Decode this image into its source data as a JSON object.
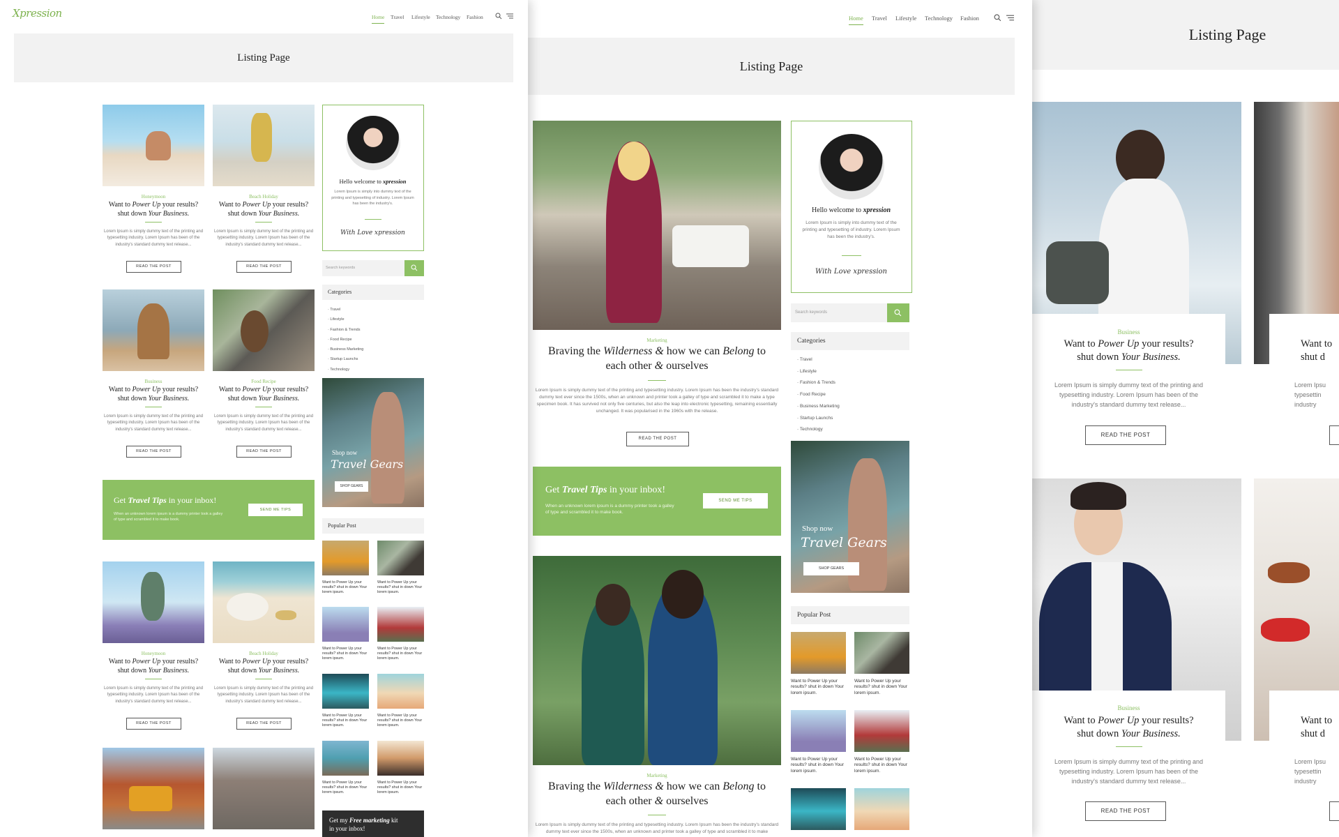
{
  "brand": {
    "logo": "Xpression"
  },
  "nav": {
    "home": "Home",
    "travel": "Travel",
    "lifestyle": "Lifestyle",
    "technology": "Technology",
    "fashion": "Fashion"
  },
  "hero": {
    "title": "Listing Page"
  },
  "post": {
    "title_1": "Want to",
    "title_em1": "Power Up",
    "title_2": "your results?",
    "title_3": "shut down",
    "title_em2": "Your Business.",
    "excerpt": "Lorem Ipsum is simply dummy text of the printing and typesetting industry. Lorem Ipsum has been of the industry's standard dummy text release...",
    "read_more": "READ THE POST"
  },
  "grid_categories": [
    "Honeymoon",
    "Beach Holiday",
    "Business",
    "Food Recipe",
    "Honeymoon",
    "Beach Holiday"
  ],
  "feature": {
    "category": "Marketing",
    "t1": "Braving the",
    "em1": "Wilderness",
    "amp1": "&",
    "t2": "how we can",
    "em2": "Belong",
    "t3": "to",
    "t4": "each other",
    "amp2": "&",
    "t5": "ourselves",
    "excerpt": "Lorem Ipsum is simply dummy text of the printing and typesetting industry. Lorem Ipsum has been the industry's standard dummy text ever since the 1500s, when an unknown and printer took a galley of type and scrambled it to make a type specimen book. It has survived not only five centuries, but also the leap into electronic typesetting, remaining essentially unchanged. It was popularised in the 1960s with the release.",
    "read_more": "READ THE POST",
    "excerpt_2": "Lorem Ipsum is simply dummy text of the printing and typesetting industry. Lorem Ipsum has been the industry's standard dummy text ever since the 1500s, when an unknown and printer took a galley of type and scrambled it to make"
  },
  "welcome": {
    "hello": "Hello welcome to",
    "brand": "xpression",
    "text": "Lorem Ipsum is simply into dummy text of the printing and typesetting of industry. Lorem Ipsum has been the industry's.",
    "signature": "With Love xpression"
  },
  "search": {
    "placeholder": "Search keywords"
  },
  "categories": {
    "title": "Categories",
    "items": [
      "Travel",
      "Lifestyle",
      "Fashion & Trends",
      "Food Recipe",
      "Business Marketing",
      "Startup Launchs",
      "Technology"
    ]
  },
  "newsletter": {
    "get": "Get",
    "em": "Travel Tips",
    "rest": "in your inbox!",
    "sub": "When an unknown lorem ipsum is a dummy printer took a galley of type and scrambled it to make book.",
    "button": "SEND ME TIPS"
  },
  "ad": {
    "shop_now": "Shop now",
    "tagline": "Travel Gears",
    "button": "SHOP GEARS"
  },
  "popular": {
    "title": "Popular Post",
    "item_text": "Want to Power Up your results? shut in down Your lorem ipsum."
  },
  "cta": {
    "get": "Get my",
    "em": "Free marketing",
    "kit": "kit",
    "rest": "in your inbox!"
  },
  "panel3": {
    "hero_title": "Listing Page",
    "category": "Business",
    "clip_1": "Want to",
    "clip_2": "shut d",
    "clip_txt_1": "Lorem Ipsu",
    "clip_txt_2": "typesettin",
    "clip_txt_3": "industry"
  },
  "colors": {
    "accent": "#8dc063",
    "hero_bg": "#f2f2f2",
    "text": "#333333"
  }
}
